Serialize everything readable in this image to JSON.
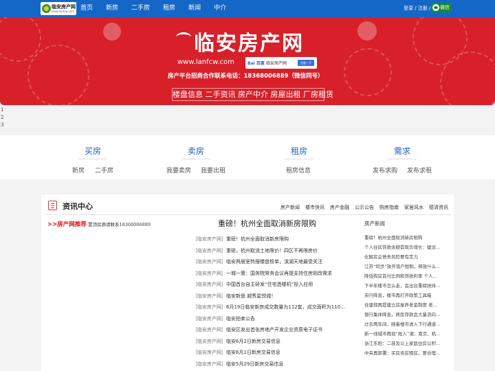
{
  "header": {
    "logo_text": "临安房产网",
    "logo_sub": "www.lanfcw.com",
    "nav": [
      "首页",
      "新房",
      "二手房",
      "租房",
      "新闻",
      "中介"
    ],
    "login_text": "登录 / 注册 /",
    "wechat_label": "微信"
  },
  "banner": {
    "title": "临安房产网",
    "url": "www.lanfcw.com",
    "card_logo": "Bai 百度",
    "card_text": "临安房产网",
    "card_button": "百度一下",
    "contact": "房产平台招商合作联系电话：18368006889（微信同号）",
    "slogan": "楼盘信息 二手资讯 房产中介 房屋出租 厂房租赁"
  },
  "lines": [
    "1",
    "2",
    "3"
  ],
  "categories": [
    {
      "title": "买房",
      "links": [
        "新房",
        "二手房"
      ]
    },
    {
      "title": "卖房",
      "links": [
        "我要卖房",
        "我要出租"
      ]
    },
    {
      "title": "租房",
      "links": [
        "租房信息"
      ]
    },
    {
      "title": "需求",
      "links": [
        "发布求购",
        "发布求租"
      ]
    }
  ],
  "news": {
    "section_title": "资讯中心",
    "tabs": [
      "房产新闻",
      "楼市快讯",
      "房产金融",
      "公示公告",
      "购房指南",
      "家居风水",
      "德清资讯"
    ],
    "promo_arrow": ">>",
    "promo_label": "房产网推荐",
    "promo_text": "-置顶房源请联系18368006889",
    "headline": "重磅！杭州全面取消新房限购",
    "items": [
      {
        "source": "［临安房产网］",
        "title": "重磅！杭州全面取消新房限购"
      },
      {
        "source": "［临安房产网］",
        "title": "重磅，杭州取消土地限价！四区不再限房价"
      },
      {
        "source": "［临安房产网］",
        "title": "临安两居室热搜楼盘榜单，滨湖天地最受关注"
      },
      {
        "source": "［临安房产网］",
        "title": "一城一策：国务院常务会议再提支持住房刚改需求"
      },
      {
        "source": "［临安房产网］",
        "title": "中国首台自主研发“住宅造楼机”投入应用"
      },
      {
        "source": "［临安房产网］",
        "title": "临安新盘 越秀星悦城！"
      },
      {
        "source": "［临安房产网］",
        "title": "6月19日临安新房成交数量为112套，成交面积为110..."
      },
      {
        "source": "［临安房产网］",
        "title": "临安拍卖公告"
      },
      {
        "source": "［临安房产网］",
        "title": "临安区发出首张房地产开发企业资质电子证书"
      },
      {
        "source": "［临安房产网］",
        "title": "临安6月2日新房交易信息"
      },
      {
        "source": "［临安房产网］",
        "title": "临安6月1日新房交易信息"
      },
      {
        "source": "［临安房产网］",
        "title": "临安5月29日新房交易信息"
      }
    ],
    "side_title": "房产新闻",
    "side_items": [
      "重磅！杭州全面取消新房限购",
      "个人住房贷款余额首现负增长：建设...",
      "化解房企债务风险要有定力",
      "江苏“同步”放开落户限制，释放什么...",
      "降低购房首付比例和贷款利率 个人...",
      "下半年楼市怎么走，会出台重磅扶持...",
      "央行降息，楼市再打开政策工具箱",
      "住建部再提建立房屋养老金制度 老...",
      "银行集体降息，居民存款会大量流向...",
      "过去两年间，随着楼市进入下行通道...",
      "新一线城市再现“抢人”潮：南京、机...",
      "浙江东阳：二孩及以上家庭住房公积...",
      "中央再部署：买房卖房租房，要合理..."
    ]
  }
}
